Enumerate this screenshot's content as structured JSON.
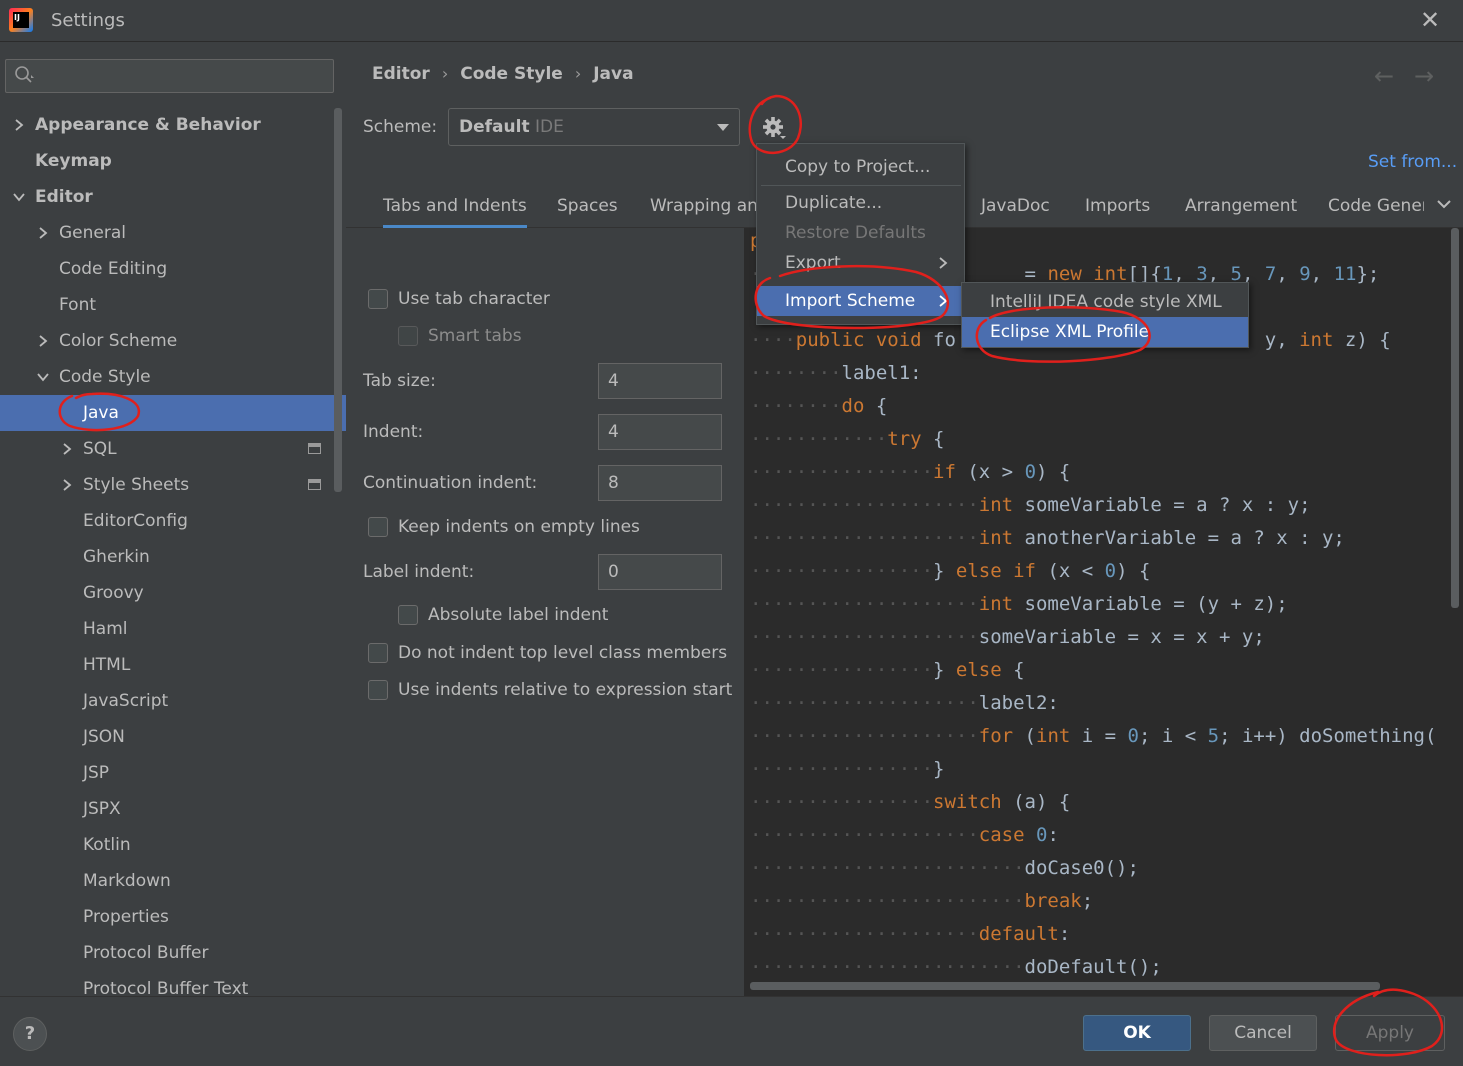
{
  "window": {
    "title": "Settings"
  },
  "sidebar": {
    "search_placeholder": "",
    "items": [
      {
        "label": "Appearance & Behavior",
        "indent": 0,
        "chevron": "right",
        "bold": true
      },
      {
        "label": "Keymap",
        "indent": 0,
        "chevron": "none",
        "bold": true
      },
      {
        "label": "Editor",
        "indent": 0,
        "chevron": "down",
        "bold": true
      },
      {
        "label": "General",
        "indent": 1,
        "chevron": "right"
      },
      {
        "label": "Code Editing",
        "indent": 1,
        "chevron": "none"
      },
      {
        "label": "Font",
        "indent": 1,
        "chevron": "none"
      },
      {
        "label": "Color Scheme",
        "indent": 1,
        "chevron": "right"
      },
      {
        "label": "Code Style",
        "indent": 1,
        "chevron": "down"
      },
      {
        "label": "Java",
        "indent": 2,
        "chevron": "none",
        "selected": true
      },
      {
        "label": "SQL",
        "indent": 2,
        "chevron": "right",
        "project_icon": true
      },
      {
        "label": "Style Sheets",
        "indent": 2,
        "chevron": "right",
        "project_icon": true
      },
      {
        "label": "EditorConfig",
        "indent": 2,
        "chevron": "none"
      },
      {
        "label": "Gherkin",
        "indent": 2,
        "chevron": "none"
      },
      {
        "label": "Groovy",
        "indent": 2,
        "chevron": "none"
      },
      {
        "label": "Haml",
        "indent": 2,
        "chevron": "none"
      },
      {
        "label": "HTML",
        "indent": 2,
        "chevron": "none"
      },
      {
        "label": "JavaScript",
        "indent": 2,
        "chevron": "none"
      },
      {
        "label": "JSON",
        "indent": 2,
        "chevron": "none"
      },
      {
        "label": "JSP",
        "indent": 2,
        "chevron": "none"
      },
      {
        "label": "JSPX",
        "indent": 2,
        "chevron": "none"
      },
      {
        "label": "Kotlin",
        "indent": 2,
        "chevron": "none"
      },
      {
        "label": "Markdown",
        "indent": 2,
        "chevron": "none"
      },
      {
        "label": "Properties",
        "indent": 2,
        "chevron": "none"
      },
      {
        "label": "Protocol Buffer",
        "indent": 2,
        "chevron": "none"
      },
      {
        "label": "Protocol Buffer Text",
        "indent": 2,
        "chevron": "none"
      }
    ]
  },
  "breadcrumb": [
    "Editor",
    "Code Style",
    "Java"
  ],
  "scheme": {
    "label": "Scheme:",
    "name": "Default",
    "scope": "IDE",
    "set_from": "Set from..."
  },
  "tabs": [
    "Tabs and Indents",
    "Spaces",
    "Wrapping and Braces",
    "JavaDoc",
    "Imports",
    "Arrangement",
    "Code Generation"
  ],
  "form": {
    "use_tab_character": "Use tab character",
    "smart_tabs": "Smart tabs",
    "tab_size_label": "Tab size:",
    "tab_size": "4",
    "indent_label": "Indent:",
    "indent": "4",
    "continuation_indent_label": "Continuation indent:",
    "continuation_indent": "8",
    "keep_indents_empty": "Keep indents on empty lines",
    "label_indent_label": "Label indent:",
    "label_indent": "0",
    "absolute_label_indent": "Absolute label indent",
    "no_indent_top_level": "Do not indent top level class members",
    "indents_relative": "Use indents relative to expression start"
  },
  "gear_menu": {
    "copy_to_project": "Copy to Project...",
    "duplicate": "Duplicate...",
    "restore_defaults": "Restore Defaults",
    "export": "Export",
    "import_scheme": "Import Scheme"
  },
  "import_submenu": {
    "intellij_xml": "IntelliJ IDEA code style XML",
    "eclipse_xml": "Eclipse XML Profile"
  },
  "buttons": {
    "ok": "OK",
    "cancel": "Cancel",
    "apply": "Apply",
    "help": "?"
  },
  "colors": {
    "accent": "#4b6eaf",
    "annotation": "#e0201c",
    "keyword": "#cc7832",
    "number": "#6897bb"
  }
}
